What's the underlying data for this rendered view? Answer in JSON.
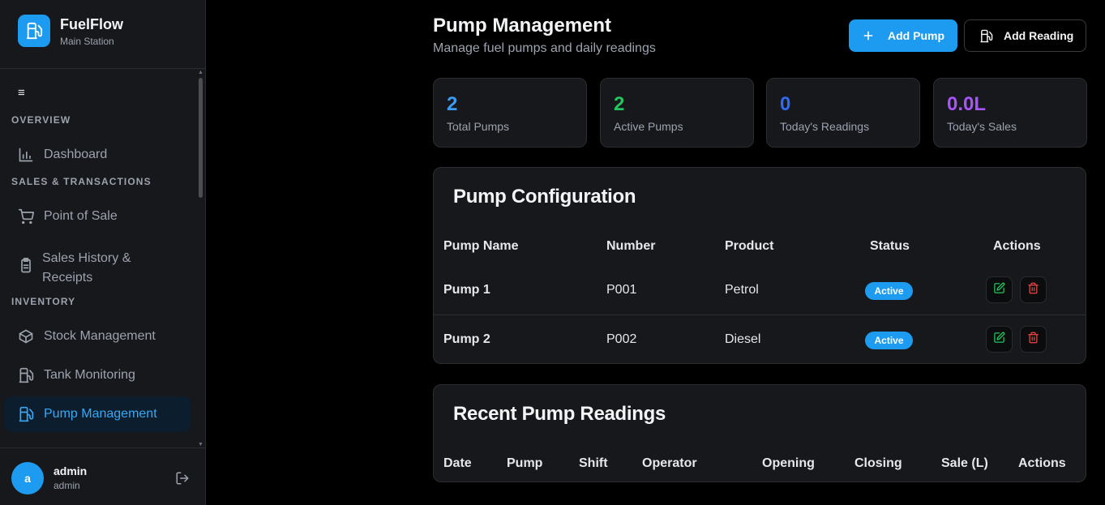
{
  "brand": {
    "name": "FuelFlow",
    "subtitle": "Main Station",
    "accent": "#1d9bf0",
    "icon": "fuel-pump-icon"
  },
  "sidebar": {
    "sections": {
      "overview": "OVERVIEW",
      "sales": "SALES & TRANSACTIONS",
      "inventory": "INVENTORY"
    },
    "items": [
      {
        "label": "Dashboard",
        "icon": "bar-chart-icon"
      },
      {
        "label": "Point of Sale",
        "icon": "cart-icon"
      },
      {
        "label": "Sales History & Receipts",
        "icon": "clipboard-icon"
      },
      {
        "label": "Stock Management",
        "icon": "box-icon"
      },
      {
        "label": "Tank Monitoring",
        "icon": "fuel-pump-icon"
      },
      {
        "label": "Pump Management",
        "icon": "fuel-pump-icon",
        "active": true
      }
    ]
  },
  "user": {
    "initial": "a",
    "name": "admin",
    "role": "admin"
  },
  "header": {
    "title": "Pump Management",
    "subtitle": "Manage fuel pumps and daily readings",
    "add_pump": "Add Pump",
    "add_reading": "Add Reading"
  },
  "stats": [
    {
      "value": "2",
      "label": "Total Pumps",
      "color": "#3b9cf5"
    },
    {
      "value": "2",
      "label": "Active Pumps",
      "color": "#22c55e"
    },
    {
      "value": "0",
      "label": "Today's Readings",
      "color": "#2f6bf0"
    },
    {
      "value": "0.0L",
      "label": "Today's Sales",
      "color": "#a855f7"
    }
  ],
  "pump_config": {
    "title": "Pump Configuration",
    "columns": [
      "Pump Name",
      "Number",
      "Product",
      "Status",
      "Actions"
    ],
    "rows": [
      {
        "name": "Pump 1",
        "number": "P001",
        "product": "Petrol",
        "status": "Active"
      },
      {
        "name": "Pump 2",
        "number": "P002",
        "product": "Diesel",
        "status": "Active"
      }
    ]
  },
  "readings": {
    "title": "Recent Pump Readings",
    "columns": [
      "Date",
      "Pump",
      "Shift",
      "Operator",
      "Opening",
      "Closing",
      "Sale (L)",
      "Actions"
    ]
  }
}
